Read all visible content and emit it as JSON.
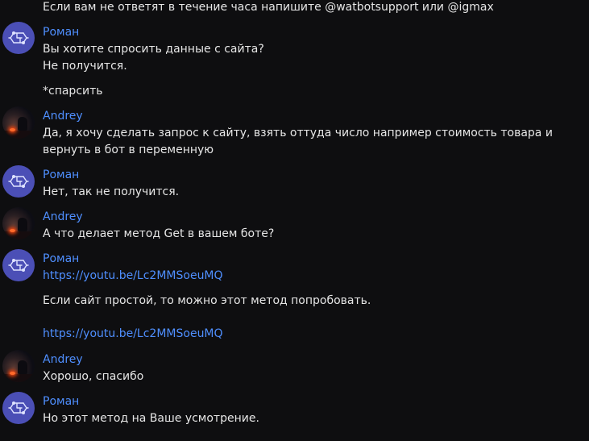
{
  "users": {
    "bot": "Роман",
    "user": "Andrey"
  },
  "messages": {
    "top_line": "Если вам не ответят в течение часа напишите @watbotsupport или @igmax",
    "m1_name": "Роман",
    "m1_line1": "Вы хотите спросить данные с сайта?",
    "m1_line2": "Не получится.",
    "m1_line3": "*спарсить",
    "m2_name": "Andrey",
    "m2_line1": "Да, я хочу сделать запрос к сайту, взять оттуда число например стоимость товара и",
    "m2_line2": "вернуть в бот в переменную",
    "m3_name": "Роман",
    "m3_line1": "Нет, так не получится.",
    "m4_name": "Andrey",
    "m4_line1": "А что делает метод Get в вашем боте?",
    "m5_name": "Роман",
    "m5_link1": "https://youtu.be/Lc2MMSoeuMQ",
    "m5_line2": "Если сайт простой, то можно этот метод попробовать.",
    "m5_link2": "https://youtu.be/Lc2MMSoeuMQ",
    "m6_name": "Andrey",
    "m6_line1": "Хорошо, спасибо",
    "m7_name": "Роман",
    "m7_line1": "Но этот метод на Ваше усмотрение."
  },
  "colors": {
    "background": "#0e0e10",
    "text": "#e6e6e6",
    "name": "#4f8fff",
    "bot_avatar": "#4b4fb6"
  },
  "icons": {
    "bot_avatar": "bot-avatar-icon",
    "user_avatar": "user-avatar-photo"
  }
}
